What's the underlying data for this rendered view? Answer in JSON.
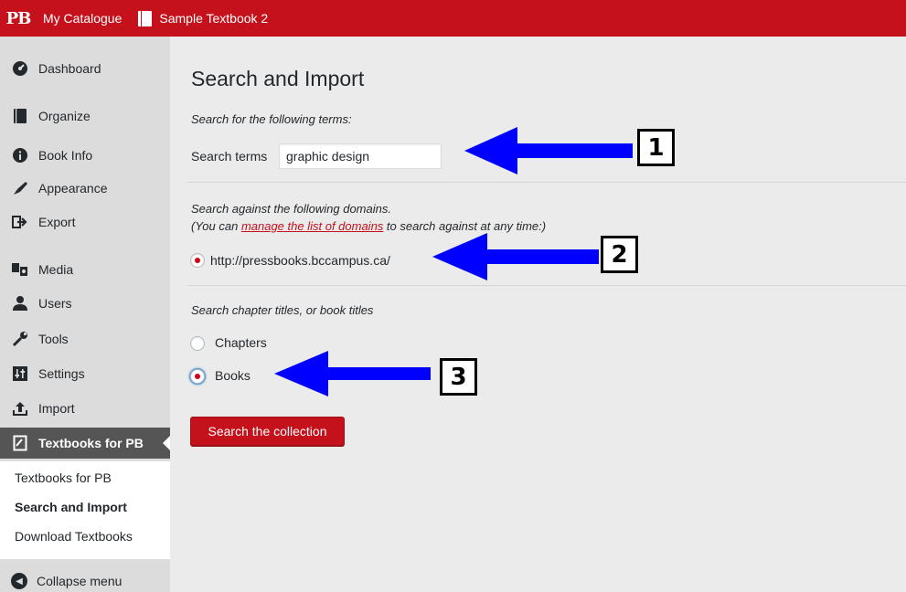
{
  "topbar": {
    "logo": "PB",
    "my_catalogue": "My Catalogue",
    "book_title": "Sample Textbook 2"
  },
  "sidebar": {
    "items": [
      {
        "label": "Dashboard",
        "icon": "dashboard-icon"
      },
      {
        "label": "Organize",
        "icon": "book-icon"
      },
      {
        "label": "Book Info",
        "icon": "info-icon"
      },
      {
        "label": "Appearance",
        "icon": "brush-icon"
      },
      {
        "label": "Export",
        "icon": "export-icon"
      },
      {
        "label": "Media",
        "icon": "media-icon"
      },
      {
        "label": "Users",
        "icon": "user-icon"
      },
      {
        "label": "Tools",
        "icon": "wrench-icon"
      },
      {
        "label": "Settings",
        "icon": "settings-icon"
      },
      {
        "label": "Import",
        "icon": "import-icon"
      },
      {
        "label": "Textbooks for PB",
        "icon": "textbook-icon",
        "active": true
      }
    ],
    "submenu": [
      {
        "label": "Textbooks for PB"
      },
      {
        "label": "Search and Import",
        "current": true
      },
      {
        "label": "Download Textbooks"
      }
    ],
    "collapse_label": "Collapse menu"
  },
  "main": {
    "title": "Search and Import",
    "search_intro": "Search for the following terms:",
    "search_label": "Search terms",
    "search_value": "graphic design",
    "domains_intro": "Search against the following domains.",
    "domains_note_before": "(You can ",
    "domains_note_link": "manage the list of domains",
    "domains_note_after": " to search against at any time:)",
    "domain_option": "http://pressbooks.bccampus.ca/",
    "scope_intro": "Search chapter titles, or book titles",
    "scope_options": [
      {
        "label": "Chapters",
        "checked": false
      },
      {
        "label": "Books",
        "checked": true
      }
    ],
    "submit_label": "Search the collection"
  },
  "annotations": {
    "callouts": [
      "1",
      "2",
      "3"
    ],
    "arrow_color": "#0000ff"
  },
  "colors": {
    "brand": "#c4111b",
    "sidebar_bg": "#dcdcdc",
    "content_bg": "#ebebeb",
    "active_menu_bg": "#555555"
  }
}
